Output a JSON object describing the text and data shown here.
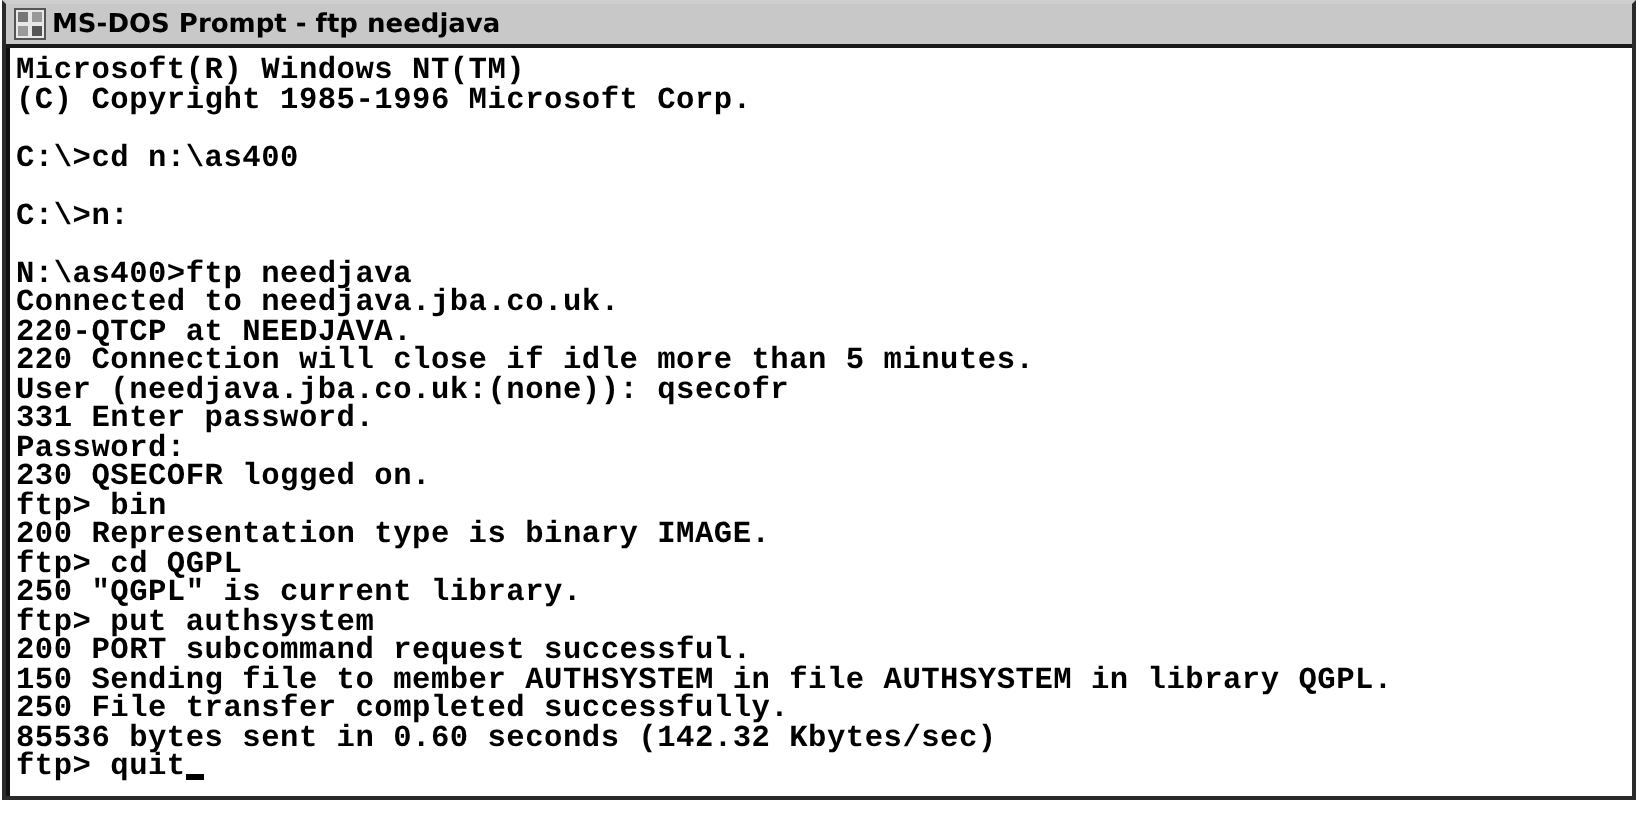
{
  "window": {
    "title": "MS-DOS Prompt - ftp needjava"
  },
  "console": {
    "cursor": true,
    "blocks": [
      {
        "lines": [
          "Microsoft(R) Windows NT(TM)",
          "(C) Copyright 1985-1996 Microsoft Corp."
        ]
      },
      {
        "lines": [
          "C:\\>cd n:\\as400"
        ]
      },
      {
        "lines": [
          "C:\\>n:"
        ]
      },
      {
        "lines": [
          "N:\\as400>ftp needjava",
          "Connected to needjava.jba.co.uk.",
          "220-QTCP at NEEDJAVA.",
          "220 Connection will close if idle more than 5 minutes.",
          "User (needjava.jba.co.uk:(none)): qsecofr",
          "331 Enter password.",
          "Password:",
          "230 QSECOFR logged on.",
          "ftp> bin",
          "200 Representation type is binary IMAGE.",
          "ftp> cd QGPL",
          "250 \"QGPL\" is current library.",
          "ftp> put authsystem",
          "200 PORT subcommand request successful.",
          "150 Sending file to member AUTHSYSTEM in file AUTHSYSTEM in library QGPL.",
          "250 File transfer completed successfully.",
          "85536 bytes sent in 0.60 seconds (142.32 Kbytes/sec)",
          "ftp> quit"
        ]
      }
    ]
  }
}
